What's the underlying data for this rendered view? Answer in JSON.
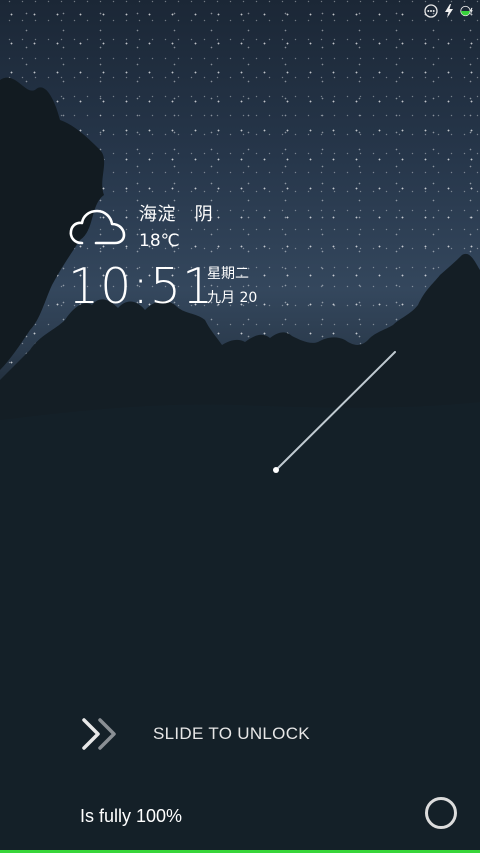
{
  "status_bar": {
    "icons": [
      "more-icon",
      "charging-bolt-icon",
      "battery-icon"
    ],
    "accent_color": "#37d23b"
  },
  "weather": {
    "icon": "cloud-icon",
    "location": "海淀   阴",
    "temperature": "18℃"
  },
  "clock": {
    "time": "10:51",
    "weekday": "星期二",
    "date": "九月 20"
  },
  "lock": {
    "slide_label": "SLIDE TO UNLOCK",
    "slide_icon": "double-chevron-right-icon",
    "battery_text": "Is fully 100%",
    "camera_icon": "circle-icon"
  },
  "battery": {
    "level": 1.0,
    "color": "#38d63a"
  }
}
